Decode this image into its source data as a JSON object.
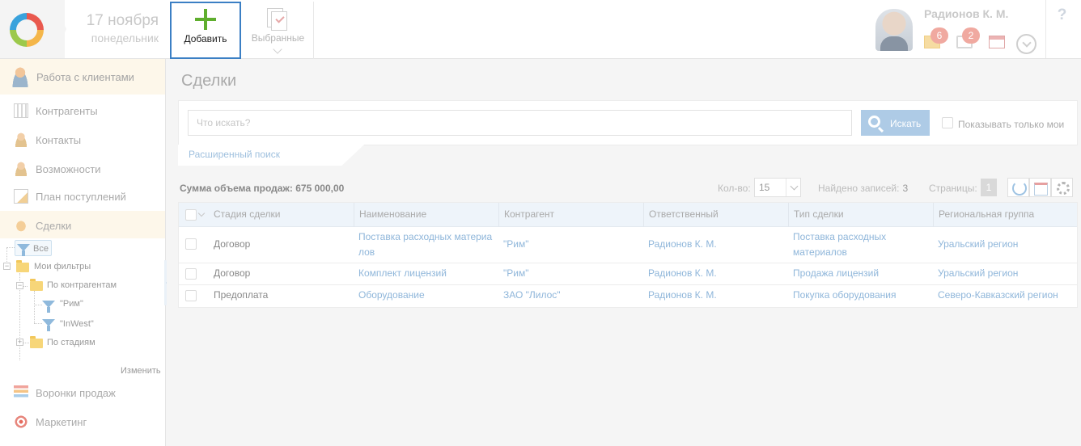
{
  "header": {
    "date_day": "17 ноября",
    "date_weekday": "понедельник",
    "add_label": "Добавить",
    "favorites_label": "Выбранные",
    "user_name": "Радионов К. М.",
    "mail_count": "6",
    "task_count": "2",
    "help": "?"
  },
  "sidebar": {
    "section": "Работа с клиентами",
    "items": [
      {
        "label": "Контрагенты",
        "icon": "building-icon"
      },
      {
        "label": "Контакты",
        "icon": "person-icon"
      },
      {
        "label": "Возможности",
        "icon": "person-icon"
      },
      {
        "label": "План поступлений",
        "icon": "document-icon"
      },
      {
        "label": "Сделки",
        "icon": "handshake-icon"
      }
    ],
    "tree": {
      "all": "Все",
      "my_filters": "Мои фильтры",
      "by_contractors": "По контрагентам",
      "filter_rim": "\"Рим\"",
      "filter_inwest": "\"InWest\"",
      "by_stages": "По стадиям"
    },
    "change_link": "Изменить",
    "bottom_items": [
      {
        "label": "Воронки продаж",
        "icon": "funnel-chart-icon"
      },
      {
        "label": "Маркетинг",
        "icon": "target-icon"
      }
    ]
  },
  "main": {
    "title": "Сделки",
    "search": {
      "placeholder": "Что искать?",
      "button": "Искать",
      "only_mine": "Показывать только мои",
      "advanced": "Расширенный поиск"
    },
    "summary": "Сумма объема продаж: 675 000,00",
    "qty_label": "Кол-во:",
    "qty_value": "15",
    "found_label": "Найдено записей:",
    "found_value": "3",
    "pages_label": "Страницы:",
    "page": "1",
    "columns": [
      "Стадия сделки",
      "Наименование",
      "Контрагент",
      "Ответственный",
      "Тип сделки",
      "Региональная группа"
    ],
    "rows": [
      {
        "stage": "Договор",
        "name": "Поставка расходных материа лов",
        "contractor": "\"Рим\"",
        "owner": "Радионов К. М.",
        "type": "Поставка расходных материалов",
        "region": "Уральский регион"
      },
      {
        "stage": "Договор",
        "name": "Комплект лицензий",
        "contractor": "\"Рим\"",
        "owner": "Радионов К. М.",
        "type": "Продажа лицензий",
        "region": "Уральский регион"
      },
      {
        "stage": "Предоплата",
        "name": "Оборудование",
        "contractor": "ЗАО \"Лилос\"",
        "owner": "Радионов К. М.",
        "type": "Покупка оборудования",
        "region": "Северо-Кавказский регион"
      }
    ]
  }
}
